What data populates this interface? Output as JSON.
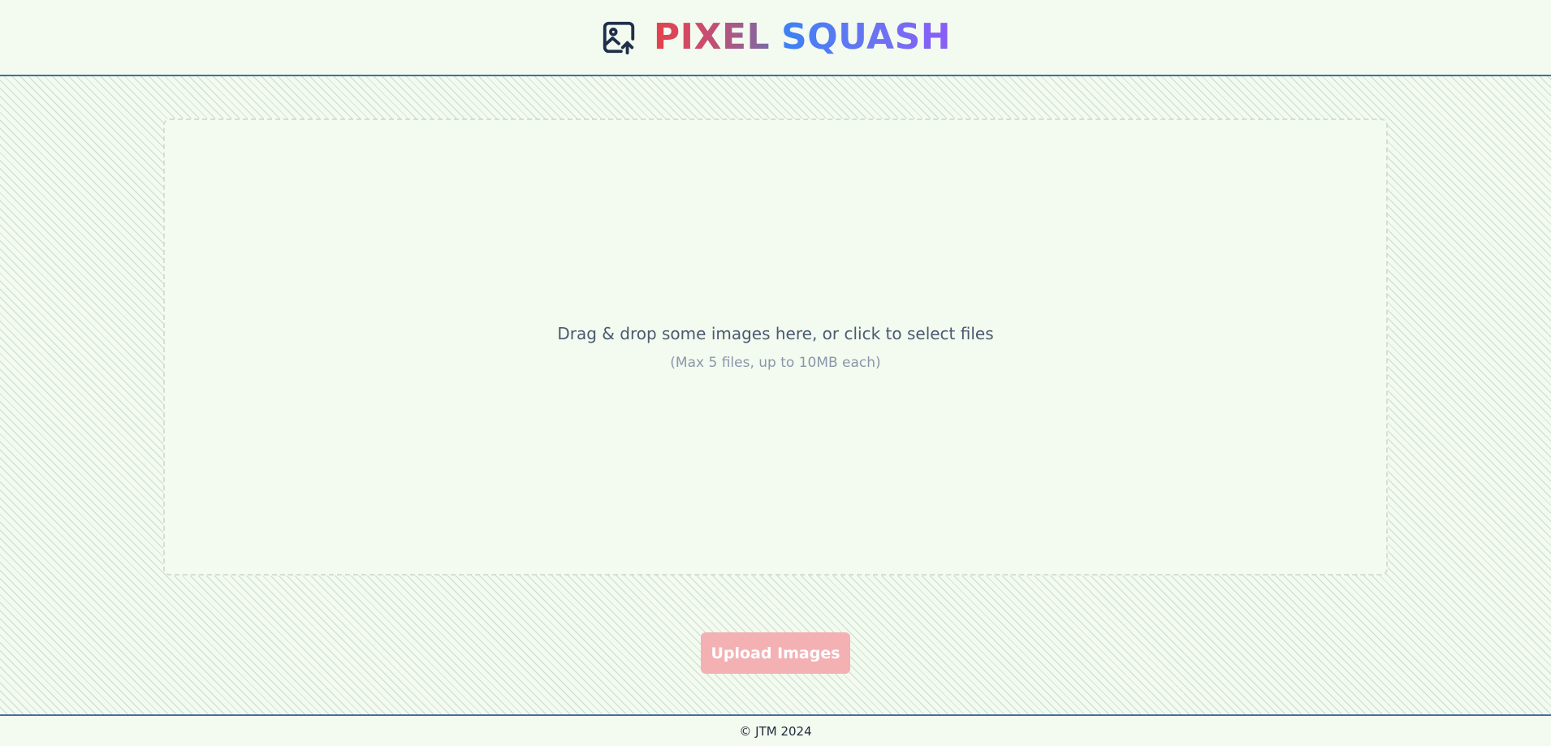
{
  "header": {
    "logo_icon": "image-upload-icon",
    "brand_word_1": "PIXEL",
    "brand_word_2": "SQUASH"
  },
  "dropzone": {
    "text": "Drag & drop some images here, or click to select files",
    "subtext": "(Max 5 files, up to 10MB each)"
  },
  "actions": {
    "upload_label": "Upload Images",
    "upload_disabled": true
  },
  "footer": {
    "text": "© JTM 2024"
  },
  "colors": {
    "background": "#f3faef",
    "accent_border": "#3f6fa6",
    "upload_button_disabled": "#f3b1b4",
    "icon_color": "#1f2f4a"
  }
}
